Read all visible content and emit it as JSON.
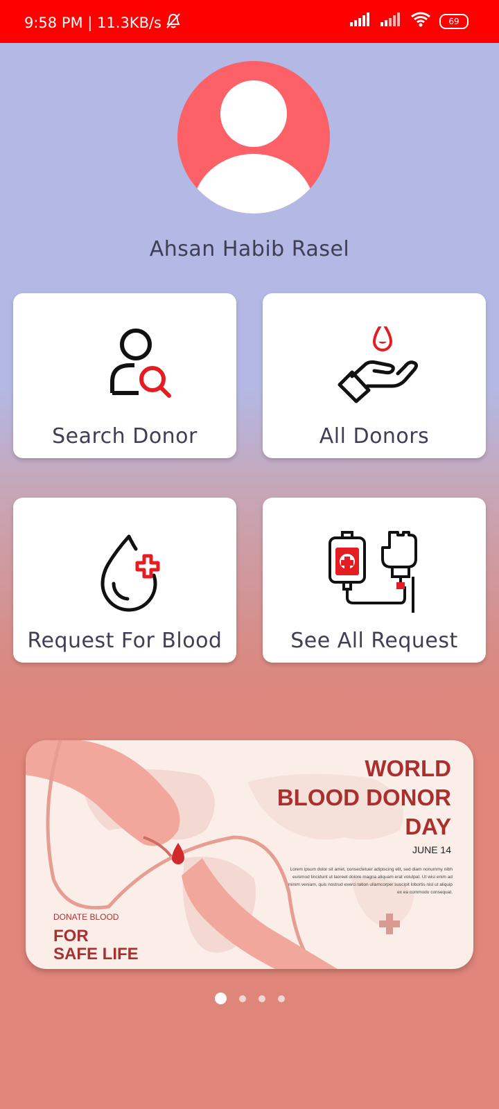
{
  "status_bar": {
    "time_speed": "9:58 PM | 11.3KB/s",
    "battery": "69",
    "icons": [
      "mute-bell-icon",
      "signal-icon",
      "signal-icon",
      "wifi-icon",
      "battery-icon"
    ]
  },
  "profile": {
    "name": "Ahsan Habib Rasel",
    "avatar_icon": "user-icon"
  },
  "menu": [
    {
      "label": "Search Donor",
      "icon": "search-user-icon"
    },
    {
      "label": "All Donors",
      "icon": "blood-drop-hand-icon"
    },
    {
      "label": "Request For Blood",
      "icon": "blood-drop-plus-icon"
    },
    {
      "label": "See All Request",
      "icon": "blood-bag-transfusion-icon"
    }
  ],
  "banner": {
    "title_lines": [
      "WORLD",
      "BLOOD DONOR",
      "DAY"
    ],
    "date": "JUNE 14",
    "lorem": "Lorem ipsum dolor sit amet, consectetuer adipiscing elit, sed diam nonummy nibh euismod tincidunt ut laoreet dolore magna aliquam erat volutpat. Ut wisi enim ad minim veniam, quis nostrud exerci tation ullamcorper suscipit lobortis nisl ut aliquip ex ea commodo consequat.",
    "donate": "DONATE BLOOD",
    "safe_line1": "FOR",
    "safe_line2": "SAFE LIFE"
  },
  "carousel": {
    "count": 4,
    "active": 1
  },
  "colors": {
    "status_bar": "#ff0000",
    "avatar": "#fb6166",
    "accent": "#e41d23",
    "banner_text": "#a9302f"
  }
}
